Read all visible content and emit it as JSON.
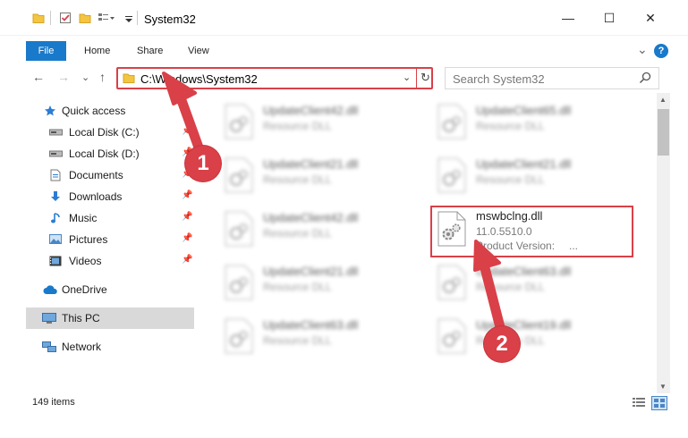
{
  "window": {
    "title": "System32",
    "minimize_glyph": "—",
    "maximize_glyph": "☐",
    "close_glyph": "✕"
  },
  "ribbon": {
    "tabs": [
      "File",
      "Home",
      "Share",
      "View"
    ],
    "expand_glyph": "⌄",
    "help_glyph": "?"
  },
  "nav": {
    "back_glyph": "←",
    "forward_glyph": "→",
    "recent_glyph": "⌄",
    "up_glyph": "↑",
    "address": "C:\\Windows\\System32",
    "address_chevron": "⌄",
    "refresh_glyph": "↻",
    "search_placeholder": "Search System32"
  },
  "sidebar": {
    "items": [
      {
        "label": "Quick access",
        "icon": "star-icon",
        "pinned": false
      },
      {
        "label": "Local Disk (C:)",
        "icon": "drive-icon",
        "pinned": true
      },
      {
        "label": "Local Disk (D:)",
        "icon": "drive-icon",
        "pinned": true
      },
      {
        "label": "Documents",
        "icon": "documents-icon",
        "pinned": true
      },
      {
        "label": "Downloads",
        "icon": "download-icon",
        "pinned": true
      },
      {
        "label": "Music",
        "icon": "music-icon",
        "pinned": true
      },
      {
        "label": "Pictures",
        "icon": "pictures-icon",
        "pinned": true
      },
      {
        "label": "Videos",
        "icon": "videos-icon",
        "pinned": true
      },
      {
        "label": "OneDrive",
        "icon": "cloud-icon",
        "pinned": false
      },
      {
        "label": "This PC",
        "icon": "pc-icon",
        "pinned": false,
        "selected": true
      },
      {
        "label": "Network",
        "icon": "network-icon",
        "pinned": false
      }
    ],
    "pin_glyph": "📌"
  },
  "files": [
    {
      "name": "UpdateClient42.dll",
      "type": "Resource DLL",
      "blurred": true
    },
    {
      "name": "UpdateClient65.dll",
      "type": "Resource DLL",
      "blurred": true
    },
    {
      "name": "UpdateClient21.dll",
      "type": "Resource DLL",
      "blurred": true
    },
    {
      "name": "UpdateClient21.dll",
      "type": "Resource DLL",
      "blurred": true
    },
    {
      "name": "UpdateClient42.dll",
      "type": "Resource DLL",
      "blurred": true
    },
    {
      "name": "mswbclng.dll",
      "version": "11.0.5510.0",
      "product_label": "Product Version:",
      "product_value": "...",
      "blurred": false
    },
    {
      "name": "UpdateClient21.dll",
      "type": "Resource DLL",
      "blurred": true
    },
    {
      "name": "UpdateClient63.dll",
      "type": "Resource DLL",
      "blurred": true
    },
    {
      "name": "UpdateClient63.dll",
      "type": "Resource DLL",
      "blurred": true
    },
    {
      "name": "UpdateClient19.dll",
      "type": "Resource DLL",
      "blurred": true
    }
  ],
  "status": {
    "item_count": "149 items"
  },
  "callouts": [
    "1",
    "2"
  ],
  "colors": {
    "accent": "#1979ca",
    "highlight": "#d94048",
    "selected_bg": "#d9d9d9"
  }
}
